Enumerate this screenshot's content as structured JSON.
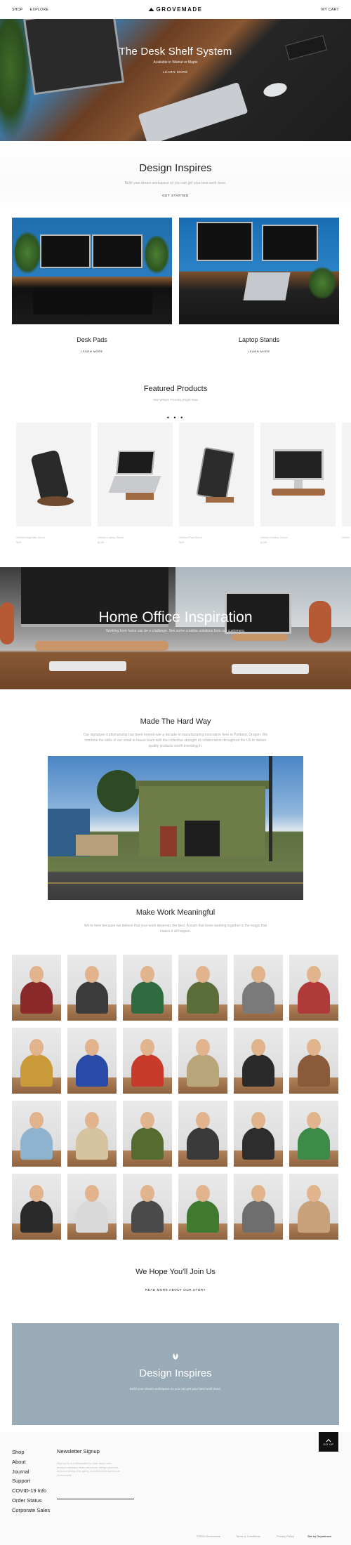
{
  "header": {
    "nav": [
      "SHOP",
      "EXPLORE"
    ],
    "brand": "GROVEMADE",
    "cart": "MY CART"
  },
  "hero": {
    "title": "The Desk Shelf System",
    "subtitle": "Available in Walnut or Maple",
    "cta": "LEARN MORE"
  },
  "design_inspires": {
    "title": "Design Inspires",
    "subtitle": "Build your dream workspace so you can get your best work done.",
    "cta": "GET STARTED"
  },
  "categories": [
    {
      "label": "Desk Pads",
      "cta": "LEARN MORE"
    },
    {
      "label": "Laptop Stands",
      "cta": "LEARN MORE"
    }
  ],
  "featured": {
    "title": "Featured Products",
    "subtitle": "See What's Trending Right Now",
    "dots": "• • •",
    "products": [
      {
        "name": "Walnut MagSafe Stand",
        "price": "$99"
      },
      {
        "name": "Walnut Laptop Stand",
        "price": "$149"
      },
      {
        "name": "Walnut iPad Stand",
        "price": "$99"
      },
      {
        "name": "Walnut Monitor Stand",
        "price": "$199"
      }
    ],
    "partial": "Walnu"
  },
  "office": {
    "title": "Home Office Inspiration",
    "subtitle": "Working from home can be a challenge. See some creative solutions from our customers."
  },
  "hard_way": {
    "title": "Made The Hard Way",
    "text": "Our signature craftsmanship has been honed over a decade of manufacturing innovation here in Portland, Oregon. We combine the skills of our small in-house team with the collective strength of collaborators throughout the US to deliver quality products worth investing in."
  },
  "meaningful": {
    "title": "Make Work Meaningful",
    "text": "We're here because we believe that your work deserves the best. A team that loves working together is the magic that makes it all happen."
  },
  "join": {
    "title": "We Hope You'll Join Us",
    "cta": "READ MORE ABOUT OUR STORY"
  },
  "banner": {
    "title": "Design Inspires",
    "subtitle": "Build your dream workspace so you can get your best work done."
  },
  "footer": {
    "links": [
      "Shop",
      "About",
      "Journal",
      "Support",
      "COVID-19 Info",
      "Order Status",
      "Corporate Sales"
    ],
    "newsletter_title": "Newsletter Signup",
    "newsletter_text": "Sign up to our Newsletter to hear about new product releases, learn about our design process, and everything else going on behind the scenes at Grovemade.",
    "email_placeholder": "",
    "top_label": "GO UP",
    "copyright": "©2020 Grovemade",
    "terms": "Terms & Conditions",
    "privacy": "Privacy Policy",
    "credit": "Site by Department"
  },
  "colors": {
    "banner_bg": "#9aabb8",
    "top_button_bg": "#111111"
  }
}
